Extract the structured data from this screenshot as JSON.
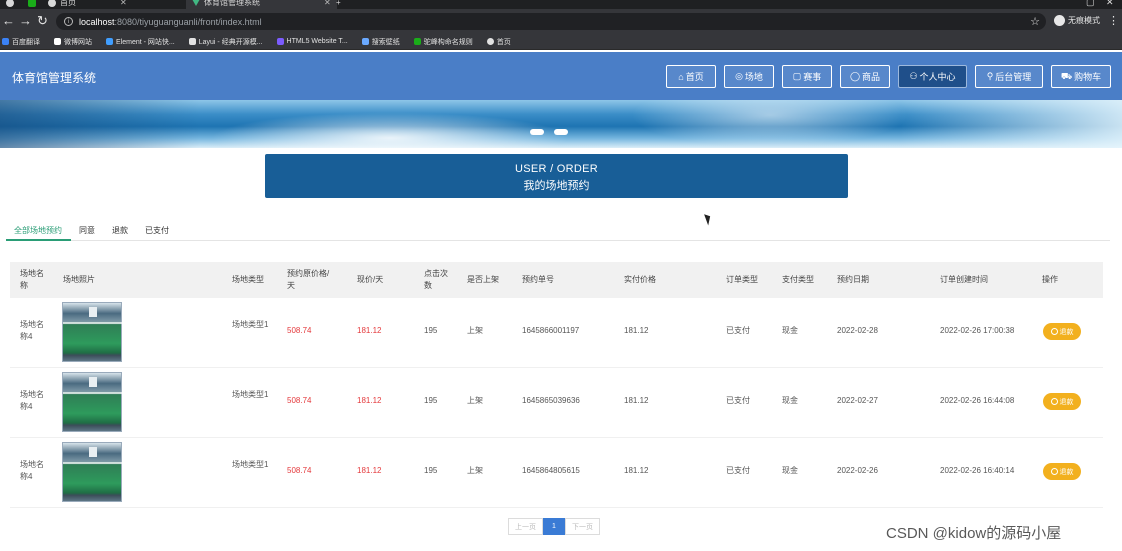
{
  "browser": {
    "tabs": [
      {
        "title": "首页",
        "icon": "browser-tab-favicon-icon"
      },
      {
        "title": "首页",
        "icon": "browser-tab-favicon-icon"
      },
      {
        "title": "体育馆管理系统",
        "icon": "vue-logo-icon"
      }
    ],
    "new_tab": "+",
    "url_host": "localhost",
    "url_path": ":8080/tiyuguanguanli/front/index.html",
    "incognito_label": "无痕模式",
    "bookmarks": [
      {
        "label": "百度翻译",
        "color": "#3b82f6"
      },
      {
        "label": "微博网站",
        "color": "#ffffff"
      },
      {
        "label": "Element - 网站快...",
        "color": "#409eff"
      },
      {
        "label": "Layui - 经典开源模...",
        "color": "#e2e2e2"
      },
      {
        "label": "HTML5 Website T...",
        "color": "#7c5cff"
      },
      {
        "label": "搜索壁纸",
        "color": "#6aa9ff"
      },
      {
        "label": "驼峰构命名规则",
        "color": "#1aad19"
      },
      {
        "label": "首页",
        "color": "#e2e2e2"
      }
    ]
  },
  "header": {
    "site_title": "体育馆管理系统",
    "nav": [
      {
        "label": "首页",
        "icon": "⌂"
      },
      {
        "label": "场地",
        "icon": "◎"
      },
      {
        "label": "赛事",
        "icon": "▢"
      },
      {
        "label": "商品",
        "icon": "◯"
      },
      {
        "label": "个人中心",
        "icon": "⚇",
        "active": true
      },
      {
        "label": "后台管理",
        "icon": "⚲"
      },
      {
        "label": "购物车",
        "icon": "⛟"
      }
    ]
  },
  "page": {
    "title_en": "USER / ORDER",
    "title_cn": "我的场地预约"
  },
  "subtabs": [
    {
      "label": "全部场地预约",
      "active": true
    },
    {
      "label": "同意"
    },
    {
      "label": "退款"
    },
    {
      "label": "已支付"
    }
  ],
  "table": {
    "headers": {
      "name": "场地名称",
      "photo": "场地照片",
      "type": "场地类型",
      "orig_price": "预约原价格/天",
      "price": "现价/天",
      "clicks": "点击次数",
      "listed": "是否上架",
      "order_no": "预约单号",
      "paid_price": "实付价格",
      "order_type": "订单类型",
      "pay_type": "支付类型",
      "date": "预约日期",
      "created": "订单创建时间",
      "action": "操作"
    },
    "rows": [
      {
        "name": "场地名称4",
        "type": "场地类型1",
        "orig_price": "508.74",
        "price": "181.12",
        "clicks": "195",
        "listed": "上架",
        "order_no": "1645866001197",
        "paid_price": "181.12",
        "order_type": "已支付",
        "pay_type": "现金",
        "date": "2022-02-28",
        "created": "2022-02-26 17:00:38",
        "action": "退款"
      },
      {
        "name": "场地名称4",
        "type": "场地类型1",
        "orig_price": "508.74",
        "price": "181.12",
        "clicks": "195",
        "listed": "上架",
        "order_no": "1645865039636",
        "paid_price": "181.12",
        "order_type": "已支付",
        "pay_type": "现金",
        "date": "2022-02-27",
        "created": "2022-02-26 16:44:08",
        "action": "退款"
      },
      {
        "name": "场地名称4",
        "type": "场地类型1",
        "orig_price": "508.74",
        "price": "181.12",
        "clicks": "195",
        "listed": "上架",
        "order_no": "1645864805615",
        "paid_price": "181.12",
        "order_type": "已支付",
        "pay_type": "现金",
        "date": "2022-02-26",
        "created": "2022-02-26 16:40:14",
        "action": "退款"
      }
    ]
  },
  "pagination": {
    "prev": "上一页",
    "current": "1",
    "next": "下一页"
  },
  "watermark": "CSDN @kidow的源码小屋",
  "colors": {
    "header_bg": "#4a7ec7",
    "title_box": "#185e97",
    "accent_green": "#2a9d76",
    "price_red": "#e4393c",
    "refund_button": "#f2b01e",
    "pager_active": "#3a7bd5"
  }
}
